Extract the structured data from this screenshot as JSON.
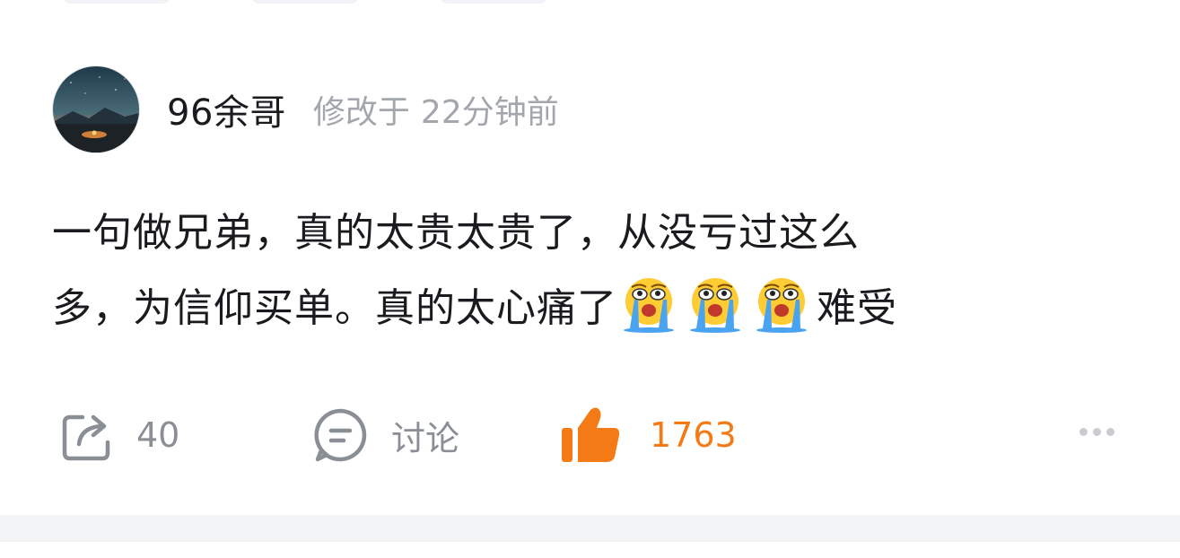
{
  "post": {
    "author": {
      "name": "96余哥",
      "avatar_icon": "night-sky-campfire-avatar"
    },
    "meta": {
      "edited_prefix": "修改于",
      "time_ago": "22分钟前"
    },
    "content": {
      "line1": "一句做兄弟，真的太贵太贵了，从没亏过这么",
      "line2_text": "多，为信仰买单。真的太心痛了",
      "emojis": [
        "crying-emoji",
        "crying-emoji",
        "crying-emoji"
      ],
      "line2_tail": "难受"
    },
    "actions": {
      "share": {
        "icon": "share-icon",
        "count": "40"
      },
      "comment": {
        "icon": "comment-icon",
        "label": "讨论"
      },
      "like": {
        "icon": "thumbs-up-icon",
        "count": "1763",
        "active_color": "#f47a15"
      },
      "more": {
        "icon": "more-dots-icon"
      }
    }
  }
}
